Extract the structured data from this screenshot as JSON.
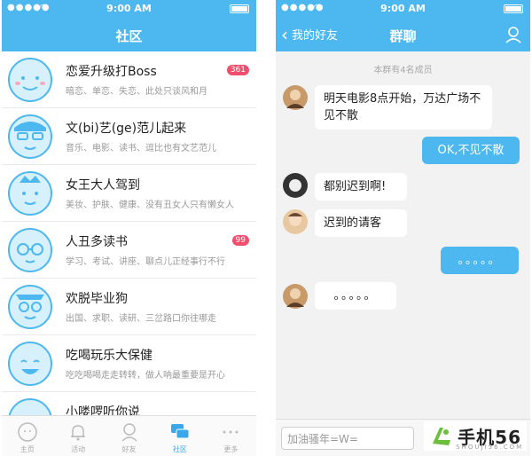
{
  "left_screen": {
    "status": {
      "time": "9:00 AM"
    },
    "nav_title": "社区",
    "groups": [
      {
        "name": "恋爱升级打Boss",
        "desc": "暗恋、单恋、失恋、此处只谈风和月",
        "badge": "361"
      },
      {
        "name": "文(bi)艺(ge)范儿起来",
        "desc": "音乐、电影、读书、逗比也有文艺范儿",
        "badge": ""
      },
      {
        "name": "女王大人驾到",
        "desc": "美妆、护肤、健康、没有丑女人只有懒女人",
        "badge": ""
      },
      {
        "name": "人丑多读书",
        "desc": "学习、考试、讲座、聊点儿正经事行不行",
        "badge": "99"
      },
      {
        "name": "欢脱毕业狗",
        "desc": "出国、求职、读研、三岔路口你往哪走",
        "badge": ""
      },
      {
        "name": "吃喝玩乐大保健",
        "desc": "吃吃喝喝走走转转，做人呐最重要是开心",
        "badge": ""
      },
      {
        "name": "小喽啰听你说",
        "desc": "",
        "badge": ""
      }
    ],
    "tabs": [
      {
        "label": "主页",
        "icon": "face-icon"
      },
      {
        "label": "活动",
        "icon": "bell-icon"
      },
      {
        "label": "好友",
        "icon": "person-icon"
      },
      {
        "label": "社区",
        "icon": "chat-bubbles-icon"
      },
      {
        "label": "更多",
        "icon": "more-dots-icon"
      }
    ]
  },
  "right_screen": {
    "status": {
      "time": "9:00 AM"
    },
    "nav_back": "我的好友",
    "nav_title": "群聊",
    "members_note": "本群有4名成员",
    "messages": [
      {
        "text": "明天电影8点开始，万达广场不见不散",
        "from": "other"
      },
      {
        "text": "OK,不见不散",
        "from": "me"
      },
      {
        "text": "都别迟到啊!",
        "from": "other"
      },
      {
        "text": "迟到的请客",
        "from": "other"
      },
      {
        "text": "。。。。。",
        "from": "me"
      },
      {
        "text": "。。。。。",
        "from": "other"
      }
    ],
    "input_placeholder": "加油骚年=W="
  },
  "watermark": {
    "main": "手机56",
    "sub": "SHOUJI56.COM"
  },
  "colors": {
    "accent": "#4db8f0",
    "badge": "#f0506e"
  }
}
